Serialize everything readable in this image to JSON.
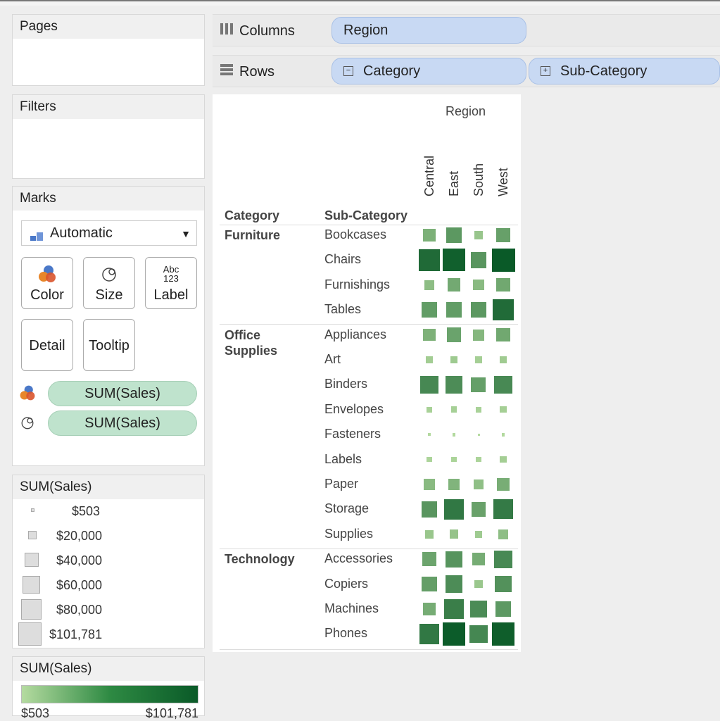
{
  "sidebar": {
    "pages_title": "Pages",
    "filters_title": "Filters",
    "marks": {
      "title": "Marks",
      "mark_type": "Automatic",
      "buttons": {
        "color": "Color",
        "size": "Size",
        "label": "Label",
        "detail": "Detail",
        "tooltip": "Tooltip"
      },
      "label_icon_text": "Abc\n123",
      "pills": [
        "SUM(Sales)",
        "SUM(Sales)"
      ]
    },
    "size_legend": {
      "title": "SUM(Sales)",
      "items": [
        "$503",
        "$20,000",
        "$40,000",
        "$60,000",
        "$80,000",
        "$101,781"
      ]
    },
    "color_legend": {
      "title": "SUM(Sales)",
      "min": "$503",
      "max": "$101,781",
      "colors": {
        "low": "#b5dba0",
        "high": "#0a5a28"
      }
    }
  },
  "shelves": {
    "columns_label": "Columns",
    "rows_label": "Rows",
    "columns_pills": [
      "Region"
    ],
    "rows_pills": [
      {
        "label": "Category",
        "state": "collapse"
      },
      {
        "label": "Sub-Category",
        "state": "expand"
      }
    ]
  },
  "view": {
    "region_header": "Region",
    "category_header": "Category",
    "subcategory_header": "Sub-Category"
  },
  "chart_data": {
    "type": "heatmap",
    "mark": "square",
    "encoding": {
      "size": "SUM(Sales)",
      "color": "SUM(Sales)"
    },
    "column_field": "Region",
    "columns": [
      "Central",
      "East",
      "South",
      "West"
    ],
    "value_range": [
      503,
      101781
    ],
    "groups": [
      {
        "category": "Furniture",
        "rows": [
          {
            "sub": "Bookcases",
            "values": [
              24000,
              43000,
              10000,
              36000
            ]
          },
          {
            "sub": "Chairs",
            "values": [
              85000,
              96000,
              45000,
              101781
            ]
          },
          {
            "sub": "Furnishings",
            "values": [
              15000,
              29000,
              17000,
              30000
            ]
          },
          {
            "sub": "Tables",
            "values": [
              39000,
              39000,
              43000,
              84000
            ]
          }
        ]
      },
      {
        "category": "Office\nSupplies",
        "rows": [
          {
            "sub": "Appliances",
            "values": [
              23000,
              34000,
              19000,
              30000
            ]
          },
          {
            "sub": "Art",
            "values": [
              5500,
              7500,
              4700,
              6700
            ]
          },
          {
            "sub": "Binders",
            "values": [
              57000,
              53000,
              37000,
              56000
            ]
          },
          {
            "sub": "Envelopes",
            "values": [
              3900,
              4400,
              3300,
              4700
            ]
          },
          {
            "sub": "Fasteners",
            "values": [
              780,
              900,
              503,
              920
            ]
          },
          {
            "sub": "Labels",
            "values": [
              2500,
              2700,
              2400,
              5100
            ]
          },
          {
            "sub": "Paper",
            "values": [
              17000,
              21000,
              14000,
              26000
            ]
          },
          {
            "sub": "Storage",
            "values": [
              45000,
              72000,
              35000,
              70000
            ]
          },
          {
            "sub": "Supplies",
            "values": [
              9500,
              11000,
              7000,
              14500
            ]
          }
        ]
      },
      {
        "category": "Technology",
        "rows": [
          {
            "sub": "Accessories",
            "values": [
              33000,
              46000,
              27000,
              56000
            ]
          },
          {
            "sub": "Copiers",
            "values": [
              38000,
              53000,
              9000,
              49000
            ]
          },
          {
            "sub": "Machines",
            "values": [
              27000,
              66000,
              54000,
              42000
            ]
          },
          {
            "sub": "Phones",
            "values": [
              72000,
              100000,
              58000,
              98000
            ]
          }
        ]
      }
    ]
  }
}
